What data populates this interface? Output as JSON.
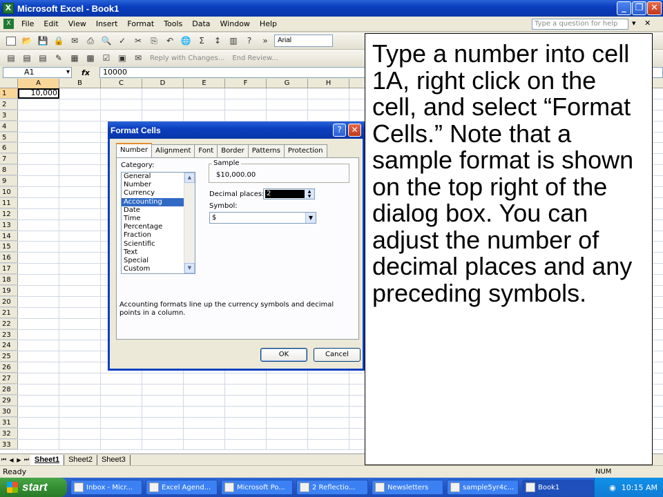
{
  "window": {
    "title": "Microsoft Excel - Book1",
    "icon": "excel-icon",
    "min": "_",
    "restore": "❐",
    "close": "✕"
  },
  "menubar": {
    "items": [
      "File",
      "Edit",
      "View",
      "Insert",
      "Format",
      "Tools",
      "Data",
      "Window",
      "Help"
    ],
    "question_placeholder": "Type a question for help",
    "doc_close": "✕"
  },
  "toolbar1": {
    "font": "Arial",
    "more": "»"
  },
  "toolbar2": {
    "reply": "Reply with Changes...",
    "end_review": "End Review..."
  },
  "formula_bar": {
    "name_box": "A1",
    "fx": "fx",
    "formula": "10000"
  },
  "grid": {
    "columns": [
      "A",
      "B",
      "C",
      "D",
      "E",
      "F",
      "G",
      "H"
    ],
    "rows": [
      "1",
      "2",
      "3",
      "4",
      "5",
      "6",
      "7",
      "8",
      "9",
      "10",
      "11",
      "12",
      "13",
      "14",
      "15",
      "16",
      "17",
      "18",
      "19",
      "20",
      "21",
      "22",
      "23",
      "24",
      "25",
      "26",
      "27",
      "28",
      "29",
      "30",
      "31",
      "32",
      "33"
    ],
    "a1_value": "10,000"
  },
  "sheets": {
    "tabs": [
      "Sheet1",
      "Sheet2",
      "Sheet3"
    ],
    "active": "Sheet1"
  },
  "status": {
    "left": "Ready",
    "num": "NUM"
  },
  "taskbar": {
    "start": "start",
    "tasks": [
      "Inbox - Micr...",
      "Excel Agend...",
      "Microsoft Po...",
      "2 Reflectio...",
      "Newsletters",
      "sample5yr4c...",
      "Book1"
    ],
    "active_task": "Book1",
    "clock": "10:15 AM"
  },
  "dialog": {
    "title": "Format Cells",
    "help": "?",
    "close": "✕",
    "tabs": [
      "Number",
      "Alignment",
      "Font",
      "Border",
      "Patterns",
      "Protection"
    ],
    "active_tab": "Number",
    "category_label": "Category:",
    "categories": [
      "General",
      "Number",
      "Currency",
      "Accounting",
      "Date",
      "Time",
      "Percentage",
      "Fraction",
      "Scientific",
      "Text",
      "Special",
      "Custom"
    ],
    "selected_category": "Accounting",
    "sample_label": "Sample",
    "sample_value": "$10,000.00",
    "decimal_label": "Decimal places:",
    "decimal_value": "2",
    "symbol_label": "Symbol:",
    "symbol_value": "$",
    "description": "Accounting formats line up the currency symbols and decimal points in a column.",
    "ok": "OK",
    "cancel": "Cancel"
  },
  "overlay": {
    "text": "Type a number into cell 1A, right click on the cell, and select “Format Cells.”  Note that a sample format is shown on the top right of the dialog box.  You can adjust the number of decimal places and any preceding symbols."
  }
}
